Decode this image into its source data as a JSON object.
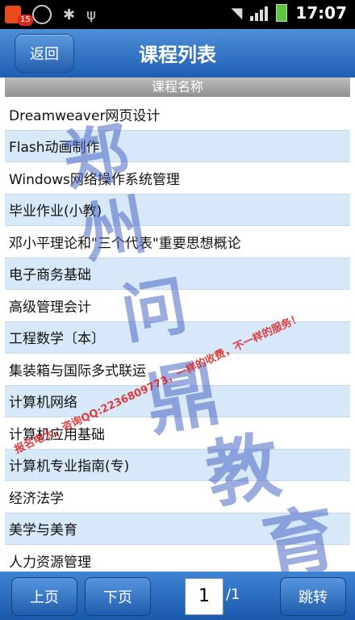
{
  "status_bar": {
    "notification_count": "15",
    "time": "17:07"
  },
  "header": {
    "back_label": "返回",
    "title": "课程列表"
  },
  "table": {
    "column_header": "课程名称",
    "rows": [
      "Dreamweaver网页设计",
      "Flash动画制作",
      "Windows网络操作系统管理",
      "毕业作业(小教)",
      "邓小平理论和\"三个代表\"重要思想概论",
      "电子商务基础",
      "高级管理会计",
      "工程数学〔本〕",
      "集装箱与国际多式联运",
      "计算机网络",
      "计算机应用基础",
      "计算机专业指南(专)",
      "经济法学",
      "美学与美育",
      "人力资源管理"
    ]
  },
  "watermark": {
    "chars": [
      "郑",
      "州",
      "问",
      "鼎",
      "教",
      "育"
    ],
    "red_line_1": "报名电大，咨询QQ:2236809773，一样的收费，不一样的服务！"
  },
  "footer": {
    "prev_label": "上页",
    "next_label": "下页",
    "page_value": "1",
    "page_total": "/1",
    "jump_label": "跳转"
  }
}
